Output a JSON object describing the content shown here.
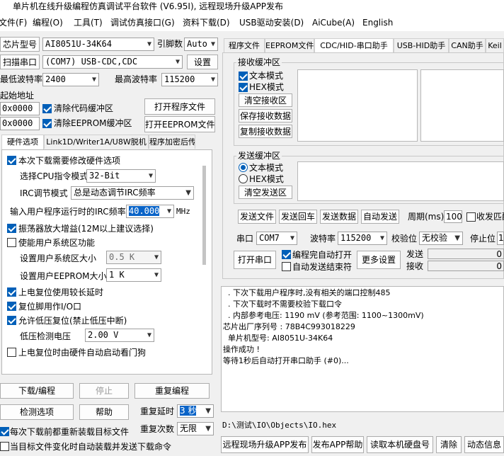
{
  "window": {
    "title": "单片机在线升级编程仿真调试平台软件 (V6.95I), 远程现场升级APP发布"
  },
  "menu": [
    "文件(F)",
    "编程(O)",
    "工具(T)",
    "调试仿真接口(G)",
    "资料下载(D)",
    "USB驱动安装(D)",
    "AiCube(A)",
    "English"
  ],
  "left": {
    "chip_label": "芯片型号",
    "chip_value": "AI8051U-34K64",
    "pin_label": "引脚数",
    "pin_value": "Auto",
    "scan_label": "扫描串口",
    "port_value": "(COM7) USB-CDC,CDC",
    "settings_button": "设置",
    "min_baud_label": "最低波特率",
    "min_baud_value": "2400",
    "max_baud_label": "最高波特率",
    "max_baud_value": "115200",
    "start_addr_label": "起始地址",
    "code_addr": "0x0000",
    "clear_code_label": "清除代码缓冲区",
    "open_program_button": "打开程序文件",
    "eeprom_addr": "0x0000",
    "clear_eeprom_label": "清除EEPROM缓冲区",
    "open_eeprom_button": "打开EEPROM文件"
  },
  "hw_tabs": [
    "硬件选项",
    "Link1D/Writer1A/U8W脱机",
    "程序加密后传"
  ],
  "hw": {
    "modify_hw_label": "本次下载需要修改硬件选项",
    "cpu_label": "选择CPU指令模式",
    "cpu_value": "32-Bit",
    "irc_label": "IRC调节模式",
    "irc_value": "总是动态调节IRC频率",
    "freq_label": "输入用户程序运行时的IRC频率",
    "freq_value": "40.000",
    "freq_unit": "MHz",
    "osc_gain_label": "振荡器放大增益(12M以上建议选择)",
    "sys_area_label": "使能用户系统区功能",
    "sys_size_label": "设置用户系统区大小",
    "sys_size_value": "0.5 K",
    "eeprom_size_label": "设置用户EEPROM大小",
    "eeprom_size_value": "1  K",
    "long_delay_label": "上电复位使用较长延时",
    "reset_io_label": "复位脚用作I/O口",
    "lvr_label": "允许低压复位(禁止低压中断)",
    "lvd_label": "低压检测电压",
    "lvd_value": "2.00 V",
    "wdt_label": "上电复位时由硬件自动启动看门狗"
  },
  "bottom_left": {
    "download_button": "下载/编程",
    "stop_button": "停止",
    "repeat_button": "重复编程",
    "detect_button": "检测选项",
    "help_button": "帮助",
    "repeat_delay_label": "重复延时",
    "repeat_delay_value": "3 秒",
    "repeat_count_label": "重复次数",
    "repeat_count_value": "无限",
    "reload_label": "每次下载前都重新装载目标文件",
    "auto_load_label": "当目标文件变化时自动装载并发送下载命令"
  },
  "right_tabs": [
    "程序文件",
    "EEPROM文件",
    "CDC/HID-串口助手",
    "USB-HID助手",
    "CAN助手",
    "Keil"
  ],
  "serial": {
    "recv_group": "接收缓冲区",
    "recv_text_mode": "文本模式",
    "recv_hex_mode": "HEX模式",
    "clear_recv": "清空接收区",
    "save_recv": "保存接收数据",
    "copy_recv": "复制接收数据",
    "send_group": "发送缓冲区",
    "send_text_mode": "文本模式",
    "send_hex_mode": "HEX模式",
    "clear_send": "清空发送区",
    "send_file": "发送文件",
    "send_enter": "发送回车",
    "send_data": "发送数据",
    "auto_send": "自动发送",
    "period_label": "周期(ms)",
    "period_value": "100",
    "recv_send_label": "收发匹配",
    "port_label": "串口",
    "port_value": "COM7",
    "baud_label": "波特率",
    "baud_value": "115200",
    "parity_label": "校验位",
    "parity_value": "无校验",
    "stop_label": "停止位",
    "stop_value": "1",
    "open_port": "打开串口",
    "auto_open_label": "编程完自动打开",
    "auto_end_label": "自动发送结束符",
    "more_settings": "更多设置",
    "send_count_label": "发送",
    "send_count": "0",
    "recv_count_label": "接收",
    "recv_count": "0"
  },
  "log": [
    "  . 下次下载用户程序时,没有相关的端口控制485",
    "  . 下次下载时不需要校验下载口令",
    "  . 内部参考电压: 1190 mV (参考范围: 1100~1300mV)",
    "芯片出厂序列号 : 78B4C993018229",
    "",
    "  单片机型号: AI8051U-34K64",
    "",
    "操作成功 !",
    "",
    "等待1秒后自动打开串口助手 (#0)..."
  ],
  "file_path": "D:\\测试\\IO\\Objects\\IO.hex",
  "bottom_buttons": [
    "远程现场升级APP发布",
    "发布APP帮助",
    "读取本机硬盘号",
    "清除",
    "动态信息"
  ]
}
